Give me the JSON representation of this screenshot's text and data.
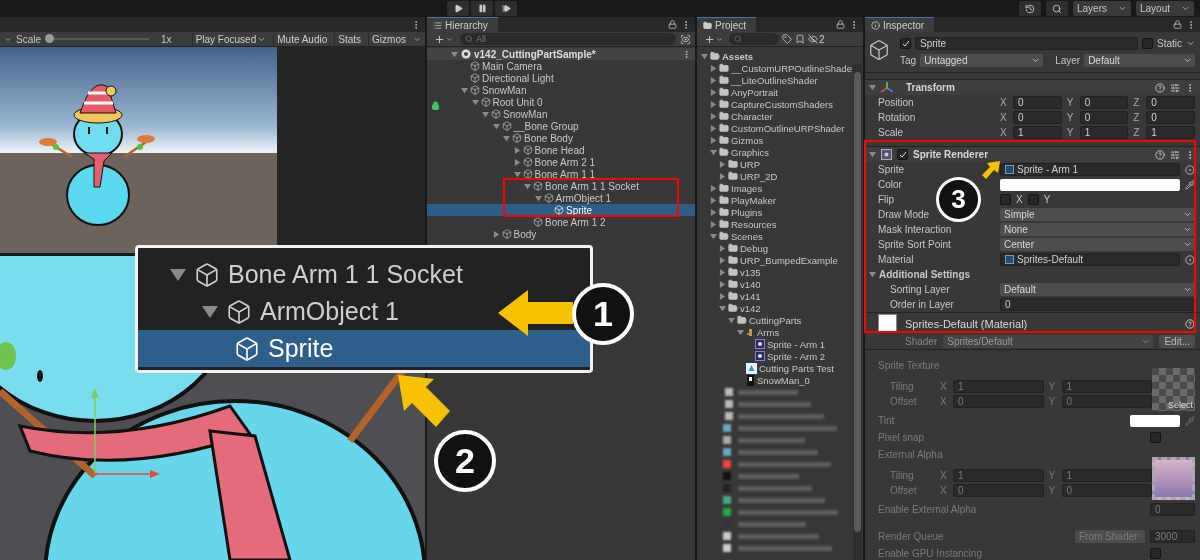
{
  "top_bar": {
    "layers": "Layers",
    "layout": "Layout"
  },
  "game_view": {
    "scale_label": "Scale",
    "scale_slider": {
      "level": 0
    },
    "scale_value": "1x",
    "play_mode": "Play Focused",
    "buttons": [
      "Mute Audio",
      "Stats",
      "Gizmos"
    ]
  },
  "hierarchy": {
    "title": "Hierarchy",
    "search": {
      "placeholder": "All"
    },
    "scene": {
      "name": "v142_CuttingPartSample*",
      "expanded": true
    },
    "items": [
      {
        "label": "Main Camera",
        "selected": false
      },
      {
        "label": "Directional Light",
        "selected": false
      },
      {
        "label": "SnowMan",
        "selected": false,
        "expanded": true,
        "children": [
          {
            "label": "Root Unit 0",
            "selected": false,
            "expanded": true,
            "children": [
              {
                "label": "SnowMan",
                "selected": false,
                "expanded": true,
                "children": [
                  {
                    "label": "__Bone Group",
                    "selected": false,
                    "expanded": true,
                    "children": [
                      {
                        "label": "Bone Body",
                        "selected": false,
                        "expanded": true,
                        "children": [
                          {
                            "label": "Bone Head",
                            "selected": false,
                            "expanded": false
                          },
                          {
                            "label": "Bone Arm 2 1",
                            "selected": false,
                            "expanded": false
                          },
                          {
                            "label": "Bone Arm 1 1",
                            "selected": false,
                            "expanded": true,
                            "children": [
                              {
                                "label": "Bone Arm 1 1 Socket",
                                "selected": false,
                                "expanded": true,
                                "children": [
                                  {
                                    "label": "ArmObject 1",
                                    "selected": false,
                                    "expanded": true,
                                    "children": [
                                      {
                                        "label": "Sprite",
                                        "selected": true
                                      }
                                    ]
                                  }
                                ]
                              },
                              {
                                "label": "Bone Arm 1 2",
                                "selected": false
                              }
                            ]
                          }
                        ]
                      }
                    ]
                  },
                  {
                    "label": "Body",
                    "selected": false,
                    "expanded": false
                  }
                ]
              }
            ]
          }
        ]
      }
    ]
  },
  "project": {
    "title": "Project",
    "hidden_count": "2",
    "items": [
      {
        "kind": "folder",
        "label": "Assets",
        "expanded": true,
        "children": [
          {
            "kind": "folder",
            "label": "__CustomURPOutlineShade",
            "expanded": false
          },
          {
            "kind": "folder",
            "label": "__LiteOutlineShader",
            "expanded": false
          },
          {
            "kind": "folder",
            "label": "AnyPortrait",
            "expanded": false
          },
          {
            "kind": "folder",
            "label": "CaptureCustomShaders",
            "expanded": false
          },
          {
            "kind": "folder",
            "label": "Character",
            "expanded": false
          },
          {
            "kind": "folder",
            "label": "CustomOutlineURPShader",
            "expanded": false
          },
          {
            "kind": "folder",
            "label": "Gizmos",
            "expanded": false
          },
          {
            "kind": "folder",
            "label": "Graphics",
            "expanded": true,
            "children": [
              {
                "kind": "folder",
                "label": "URP",
                "expanded": false
              },
              {
                "kind": "folder",
                "label": "URP_2D",
                "expanded": false
              }
            ]
          },
          {
            "kind": "folder",
            "label": "Images",
            "expanded": false
          },
          {
            "kind": "folder",
            "label": "PlayMaker",
            "expanded": false
          },
          {
            "kind": "folder",
            "label": "Plugins",
            "expanded": false
          },
          {
            "kind": "folder",
            "label": "Resources",
            "expanded": false
          },
          {
            "kind": "folder",
            "label": "Scenes",
            "expanded": true,
            "children": [
              {
                "kind": "folder",
                "label": "Debug",
                "expanded": false
              },
              {
                "kind": "folder",
                "label": "URP_BumpedExample",
                "expanded": false
              },
              {
                "kind": "folder",
                "label": "v135",
                "expanded": false
              },
              {
                "kind": "folder",
                "label": "v140",
                "expanded": false
              },
              {
                "kind": "folder",
                "label": "v141",
                "expanded": false
              },
              {
                "kind": "folder",
                "label": "v142",
                "expanded": true,
                "children": [
                  {
                    "kind": "folder",
                    "label": "CuttingParts",
                    "expanded": true,
                    "children": [
                      {
                        "kind": "sprite_sheet",
                        "label": "Arms",
                        "expanded": true,
                        "children": [
                          {
                            "kind": "sprite",
                            "label": "Sprite - Arm 1"
                          },
                          {
                            "kind": "sprite",
                            "label": "Sprite - Arm 2"
                          }
                        ]
                      },
                      {
                        "kind": "scene",
                        "label": "Cutting Parts Test"
                      },
                      {
                        "kind": "asset",
                        "label": "SnowMan_0"
                      }
                    ]
                  }
                ]
              }
            ]
          }
        ]
      }
    ]
  },
  "inspector": {
    "title": "Inspector",
    "object": {
      "active": true,
      "name": "Sprite",
      "static_label": "Static",
      "static": false,
      "tag_label": "Tag",
      "tag": "Untagged",
      "layer_label": "Layer",
      "layer": "Default"
    },
    "transform": {
      "title": "Transform",
      "expanded": true,
      "rows": [
        {
          "label": "Position",
          "values": [
            {
              "axis": "X",
              "value": "0"
            },
            {
              "axis": "Y",
              "value": "0"
            },
            {
              "axis": "Z",
              "value": "0"
            }
          ]
        },
        {
          "label": "Rotation",
          "values": [
            {
              "axis": "X",
              "value": "0"
            },
            {
              "axis": "Y",
              "value": "0"
            },
            {
              "axis": "Z",
              "value": "0"
            }
          ]
        },
        {
          "label": "Scale",
          "values": [
            {
              "axis": "X",
              "value": "1"
            },
            {
              "axis": "Y",
              "value": "1"
            },
            {
              "axis": "Z",
              "value": "1"
            }
          ]
        }
      ]
    },
    "sprite_renderer": {
      "title": "Sprite Renderer",
      "enabled": true,
      "expanded": true,
      "fields": [
        {
          "kind": "object",
          "label": "Sprite",
          "value": "Sprite - Arm 1"
        },
        {
          "kind": "color",
          "label": "Color",
          "color": "#ffffff"
        },
        {
          "kind": "flip",
          "label": "Flip",
          "options": [
            {
              "axis": "X",
              "checked": false
            },
            {
              "axis": "Y",
              "checked": false
            }
          ]
        },
        {
          "kind": "dropdown",
          "label": "Draw Mode",
          "value": "Simple"
        },
        {
          "kind": "dropdown",
          "label": "Mask Interaction",
          "value": "None"
        },
        {
          "kind": "dropdown",
          "label": "Sprite Sort Point",
          "value": "Center"
        },
        {
          "kind": "object",
          "label": "Material",
          "value": "Sprites-Default"
        },
        {
          "kind": "section",
          "label": "Additional Settings",
          "expanded": true,
          "children": [
            {
              "kind": "dropdown",
              "label": "Sorting Layer",
              "value": "Default"
            },
            {
              "kind": "number",
              "label": "Order in Layer",
              "value": "0"
            }
          ]
        }
      ]
    },
    "material": {
      "title": "Sprites-Default (Material)",
      "shader_label": "Shader",
      "shader": "Sprites/Default",
      "edit": "Edit...",
      "disabled": true,
      "properties": [
        {
          "kind": "texture",
          "label": "Sprite Texture",
          "select": "Select",
          "rows": [
            {
              "label": "Tiling",
              "values": [
                {
                  "axis": "X",
                  "value": "1"
                },
                {
                  "axis": "Y",
                  "value": "1"
                }
              ]
            },
            {
              "label": "Offset",
              "values": [
                {
                  "axis": "X",
                  "value": "0"
                },
                {
                  "axis": "Y",
                  "value": "0"
                }
              ]
            }
          ]
        },
        {
          "kind": "color",
          "label": "Tint",
          "color": "#ffffff"
        },
        {
          "kind": "checkbox",
          "label": "Pixel snap",
          "checked": false
        },
        {
          "kind": "texture",
          "label": "External Alpha",
          "rows": [
            {
              "label": "Tiling",
              "values": [
                {
                  "axis": "X",
                  "value": "1"
                },
                {
                  "axis": "Y",
                  "value": "1"
                }
              ]
            },
            {
              "label": "Offset",
              "values": [
                {
                  "axis": "X",
                  "value": "0"
                },
                {
                  "axis": "Y",
                  "value": "0"
                }
              ]
            }
          ]
        },
        {
          "kind": "number",
          "label": "Enable External Alpha",
          "value": "0"
        },
        {
          "kind": "queue",
          "label": "Render Queue",
          "mode": "From Shader",
          "value": "3000"
        },
        {
          "kind": "checkbox",
          "label": "Enable GPU Instancing",
          "checked": false
        }
      ]
    }
  },
  "callout": {
    "rows": [
      {
        "label": "Bone Arm 1 1 Socket",
        "expanded": true,
        "selected": false
      },
      {
        "label": "ArmObject 1",
        "expanded": true,
        "selected": false
      },
      {
        "label": "Sprite",
        "selected": true
      }
    ]
  },
  "annotations": [
    {
      "number": "1"
    },
    {
      "number": "2"
    },
    {
      "number": "3"
    }
  ]
}
